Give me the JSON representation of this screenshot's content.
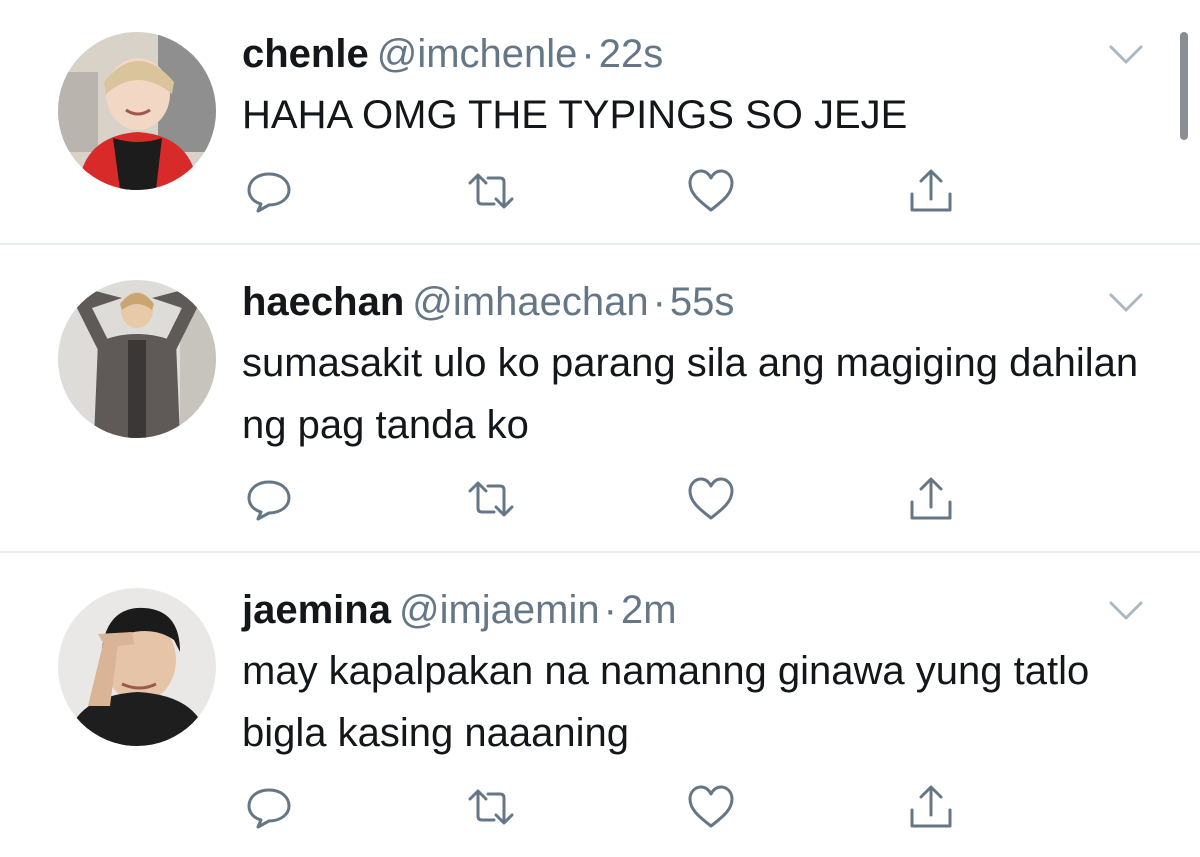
{
  "colors": {
    "name": "#14171a",
    "meta": "#657786",
    "icon": "#657786",
    "divider": "#e6ecf0"
  },
  "tweets": [
    {
      "name": "chenle",
      "handle": "@imchenle",
      "separator": "·",
      "time": "22s",
      "text": "HAHA OMG THE TYPINGS SO JEJE",
      "avatar_icon": "avatar-photo"
    },
    {
      "name": "haechan",
      "handle": "@imhaechan",
      "separator": "·",
      "time": "55s",
      "text": "sumasakit ulo ko parang sila ang magiging dahilan ng pag tanda ko",
      "avatar_icon": "avatar-photo"
    },
    {
      "name": "jaemina",
      "handle": "@imjaemin",
      "separator": "·",
      "time": "2m",
      "text": "may kapalpakan na namanng ginawa yung tatlo bigla kasing naaaning",
      "avatar_icon": "avatar-photo"
    }
  ],
  "action_icons": [
    "reply-icon",
    "retweet-icon",
    "like-icon",
    "share-icon"
  ],
  "menu_icon": "chevron-down-icon"
}
